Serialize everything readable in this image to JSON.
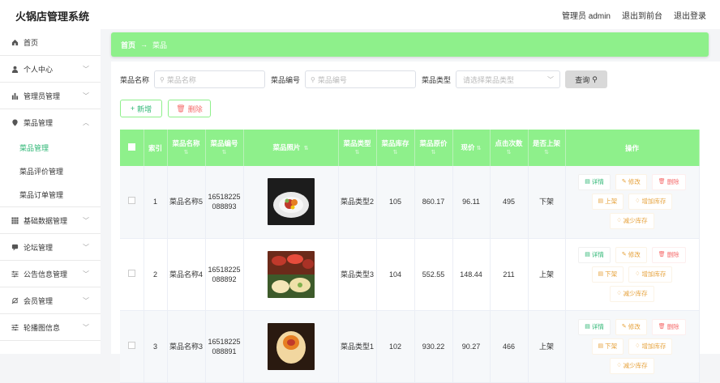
{
  "app": {
    "title": "火锅店管理系统"
  },
  "topbar": {
    "admin": "管理员 admin",
    "front": "退出到前台",
    "logout": "退出登录"
  },
  "sidebar": {
    "items": [
      {
        "label": "首页",
        "icon": "home-icon"
      },
      {
        "label": "个人中心",
        "icon": "user-icon"
      },
      {
        "label": "管理员管理",
        "icon": "bar-chart-icon"
      },
      {
        "label": "菜品管理",
        "icon": "location-pin-icon"
      },
      {
        "label": "基础数据管理",
        "icon": "grid-icon"
      },
      {
        "label": "论坛管理",
        "icon": "chat-icon"
      },
      {
        "label": "公告信息管理",
        "icon": "sliders-icon"
      },
      {
        "label": "会员管理",
        "icon": "bell-off-icon"
      },
      {
        "label": "轮播图信息",
        "icon": "sliders-icon"
      }
    ],
    "sub_items": [
      {
        "label": "菜品管理",
        "active": true
      },
      {
        "label": "菜品评价管理",
        "active": false
      },
      {
        "label": "菜品订单管理",
        "active": false
      }
    ]
  },
  "breadcrumb": {
    "home": "首页",
    "current": "菜品"
  },
  "search": {
    "name_label": "菜品名称",
    "name_placeholder": "菜品名称",
    "code_label": "菜品编号",
    "code_placeholder": "菜品编号",
    "type_label": "菜品类型",
    "type_placeholder": "请选择菜品类型",
    "query_label": "查询"
  },
  "actions": {
    "add_label": "新增",
    "delete_label": "删除"
  },
  "table": {
    "headers": [
      "索引",
      "菜品名称",
      "菜品编号",
      "菜品照片",
      "菜品类型",
      "菜品库存",
      "菜品原价",
      "现价",
      "点击次数",
      "是否上架",
      "操作"
    ],
    "rows": [
      {
        "index": "1",
        "name": "菜品名称5",
        "code": "16518225088893",
        "type": "菜品类型2",
        "stock": "105",
        "original_price": "860.17",
        "price": "96.11",
        "clicks": "495",
        "on_shelf": "下架",
        "shelf_action": "上架"
      },
      {
        "index": "2",
        "name": "菜品名称4",
        "code": "16518225088892",
        "type": "菜品类型3",
        "stock": "104",
        "original_price": "552.55",
        "price": "148.44",
        "clicks": "211",
        "on_shelf": "上架",
        "shelf_action": "下架"
      },
      {
        "index": "3",
        "name": "菜品名称3",
        "code": "16518225088891",
        "type": "菜品类型1",
        "stock": "102",
        "original_price": "930.22",
        "price": "90.27",
        "clicks": "466",
        "on_shelf": "上架",
        "shelf_action": "下架"
      }
    ],
    "ops": {
      "detail": "详情",
      "edit": "修改",
      "remove": "删除",
      "add_stock": "增加库存",
      "reduce_stock": "减少库存"
    }
  },
  "colors": {
    "accent": "#8ef08b",
    "active_text": "#2bb673",
    "danger": "#f56c6c",
    "warning": "#e6a23c"
  }
}
